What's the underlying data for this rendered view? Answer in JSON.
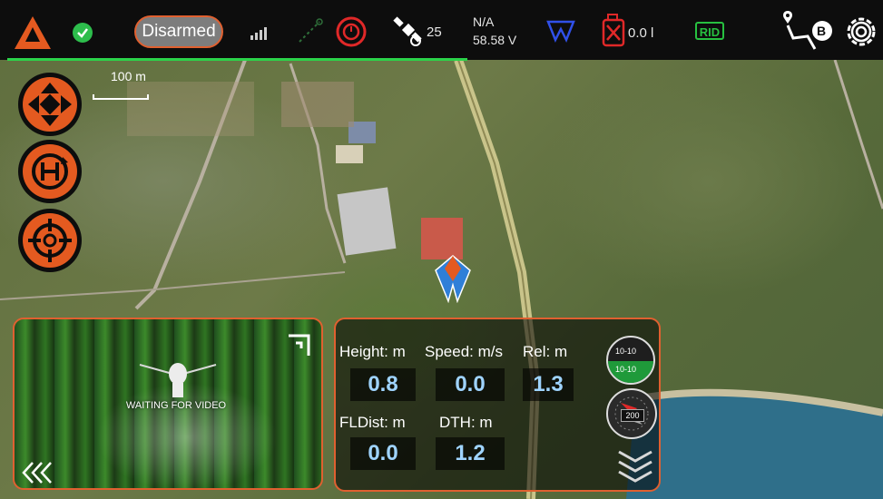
{
  "topbar": {
    "armed_state": "Disarmed",
    "satellite_count": "25",
    "voltage_top": "N/A",
    "voltage_bottom": "58.58 V",
    "fuel_value": "0.0 l",
    "rid_label": "RID",
    "waypoint_label": "B"
  },
  "map": {
    "scale_label": "100 m"
  },
  "video": {
    "status": "WAITING FOR VIDEO"
  },
  "telemetry": {
    "height_label": "Height: m",
    "height_value": "0.8",
    "speed_label": "Speed: m/s",
    "speed_value": "0.0",
    "rel_label": "Rel: m",
    "rel_value": "1.3",
    "fldist_label": "FLDist: m",
    "fldist_value": "0.0",
    "dth_label": "DTH: m",
    "dth_value": "1.2"
  },
  "attitude": {
    "top_scale": "10-10",
    "bottom_scale": "10-10",
    "heading_value": "200"
  },
  "colors": {
    "accent": "#e45a20",
    "ok": "#2dbd4c",
    "value_text": "#9fd4ff"
  }
}
